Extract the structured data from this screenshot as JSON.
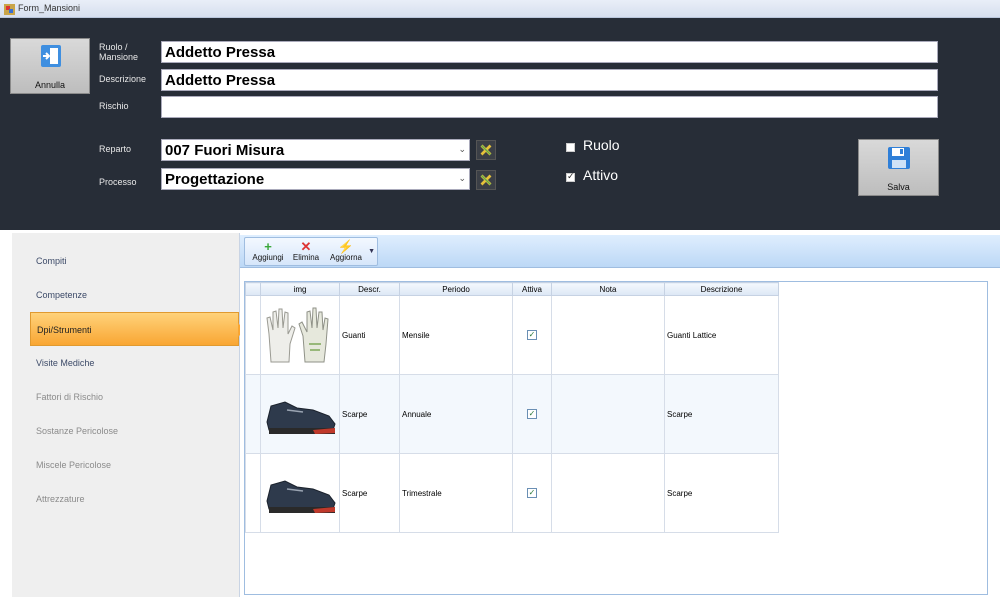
{
  "window": {
    "title": "Form_Mansioni"
  },
  "header": {
    "annulla_label": "Annulla",
    "salva_label": "Salva",
    "ruolo_label": "Ruolo / Mansione",
    "ruolo_value": "Addetto Pressa",
    "descrizione_label": "Descrizione",
    "descrizione_value": "Addetto Pressa",
    "rischio_label": "Rischio",
    "rischio_value": "",
    "reparto_label": "Reparto",
    "reparto_value": "007 Fuori Misura",
    "processo_label": "Processo",
    "processo_value": "Progettazione",
    "ruolo_check_label": "Ruolo",
    "ruolo_checked": false,
    "attivo_check_label": "Attivo",
    "attivo_checked": true
  },
  "sidebar": {
    "items": [
      {
        "label": "Compiti",
        "state": "enabled"
      },
      {
        "label": "Competenze",
        "state": "enabled"
      },
      {
        "label": "Dpi/Strumenti",
        "state": "active"
      },
      {
        "label": "Visite Mediche",
        "state": "enabled"
      },
      {
        "label": "Fattori di Rischio",
        "state": "disabled"
      },
      {
        "label": "Sostanze Pericolose",
        "state": "disabled"
      },
      {
        "label": "Miscele Pericolose",
        "state": "disabled"
      },
      {
        "label": "Attrezzature",
        "state": "disabled"
      }
    ]
  },
  "toolbar": {
    "aggiungi": "Aggiungi",
    "elimina": "Elimina",
    "aggiorna": "Aggiorna"
  },
  "grid": {
    "columns": [
      "img",
      "Descr.",
      "Periodo",
      "Attiva",
      "Nota",
      "Descrizione"
    ],
    "rows": [
      {
        "img": "gloves",
        "descr": "Guanti",
        "periodo": "Mensile",
        "attiva": true,
        "nota": "",
        "descrizione": "Guanti Lattice"
      },
      {
        "img": "shoe",
        "descr": "Scarpe",
        "periodo": "Annuale",
        "attiva": true,
        "nota": "",
        "descrizione": "Scarpe"
      },
      {
        "img": "shoe",
        "descr": "Scarpe",
        "periodo": "Trimestrale",
        "attiva": true,
        "nota": "",
        "descrizione": "Scarpe"
      }
    ]
  },
  "colors": {
    "header_bg": "#272d37",
    "active_tab": "#f9a633",
    "toolbar": "#bcd8f6"
  }
}
